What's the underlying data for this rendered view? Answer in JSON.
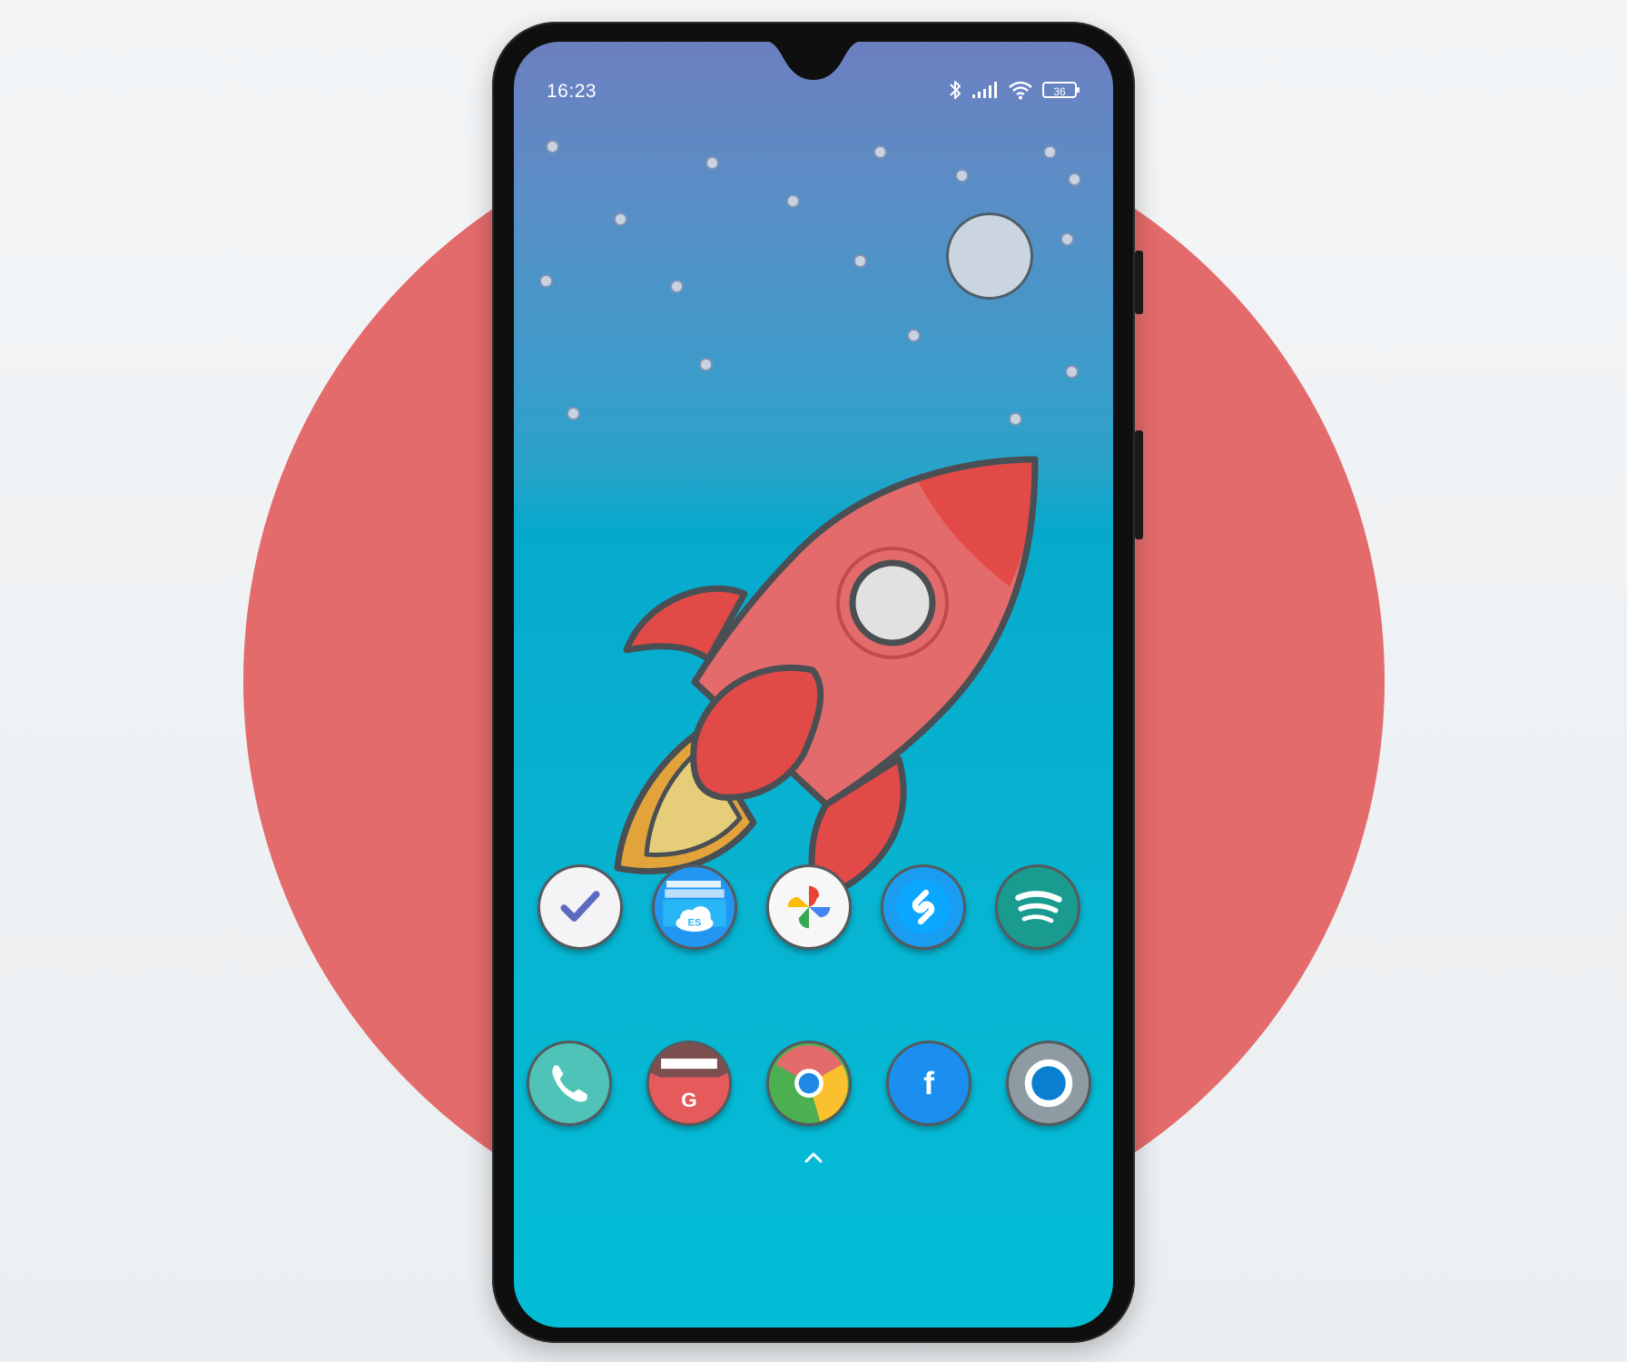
{
  "status_bar": {
    "time": "16:23",
    "battery_level": "36",
    "icons": [
      "bluetooth-icon",
      "signal-icon",
      "wifi-icon",
      "battery-icon"
    ]
  },
  "wallpaper": {
    "subject": "rocket-illustration",
    "colors": {
      "sky_top": "#6d7fc0",
      "sky_bottom": "#03bdd6",
      "rocket": "#e46b6b",
      "background_circle": "#e46b6b"
    }
  },
  "home_row": [
    {
      "app": "tasks",
      "icon": "checkmark-icon"
    },
    {
      "app": "es-file-explorer",
      "icon": "folder-cloud-icon"
    },
    {
      "app": "google-photos",
      "icon": "pinwheel-icon"
    },
    {
      "app": "shazam",
      "icon": "shazam-icon"
    },
    {
      "app": "spotify",
      "icon": "spotify-icon"
    }
  ],
  "app_drawer": {
    "icon": "chevron-up-icon"
  },
  "dock": [
    {
      "app": "phone",
      "icon": "phone-icon"
    },
    {
      "app": "gmail",
      "icon": "mail-icon",
      "letter": "G"
    },
    {
      "app": "chrome",
      "icon": "chrome-icon"
    },
    {
      "app": "facebook",
      "icon": "facebook-icon",
      "letter": "f"
    },
    {
      "app": "camera",
      "icon": "camera-ring-icon"
    }
  ]
}
